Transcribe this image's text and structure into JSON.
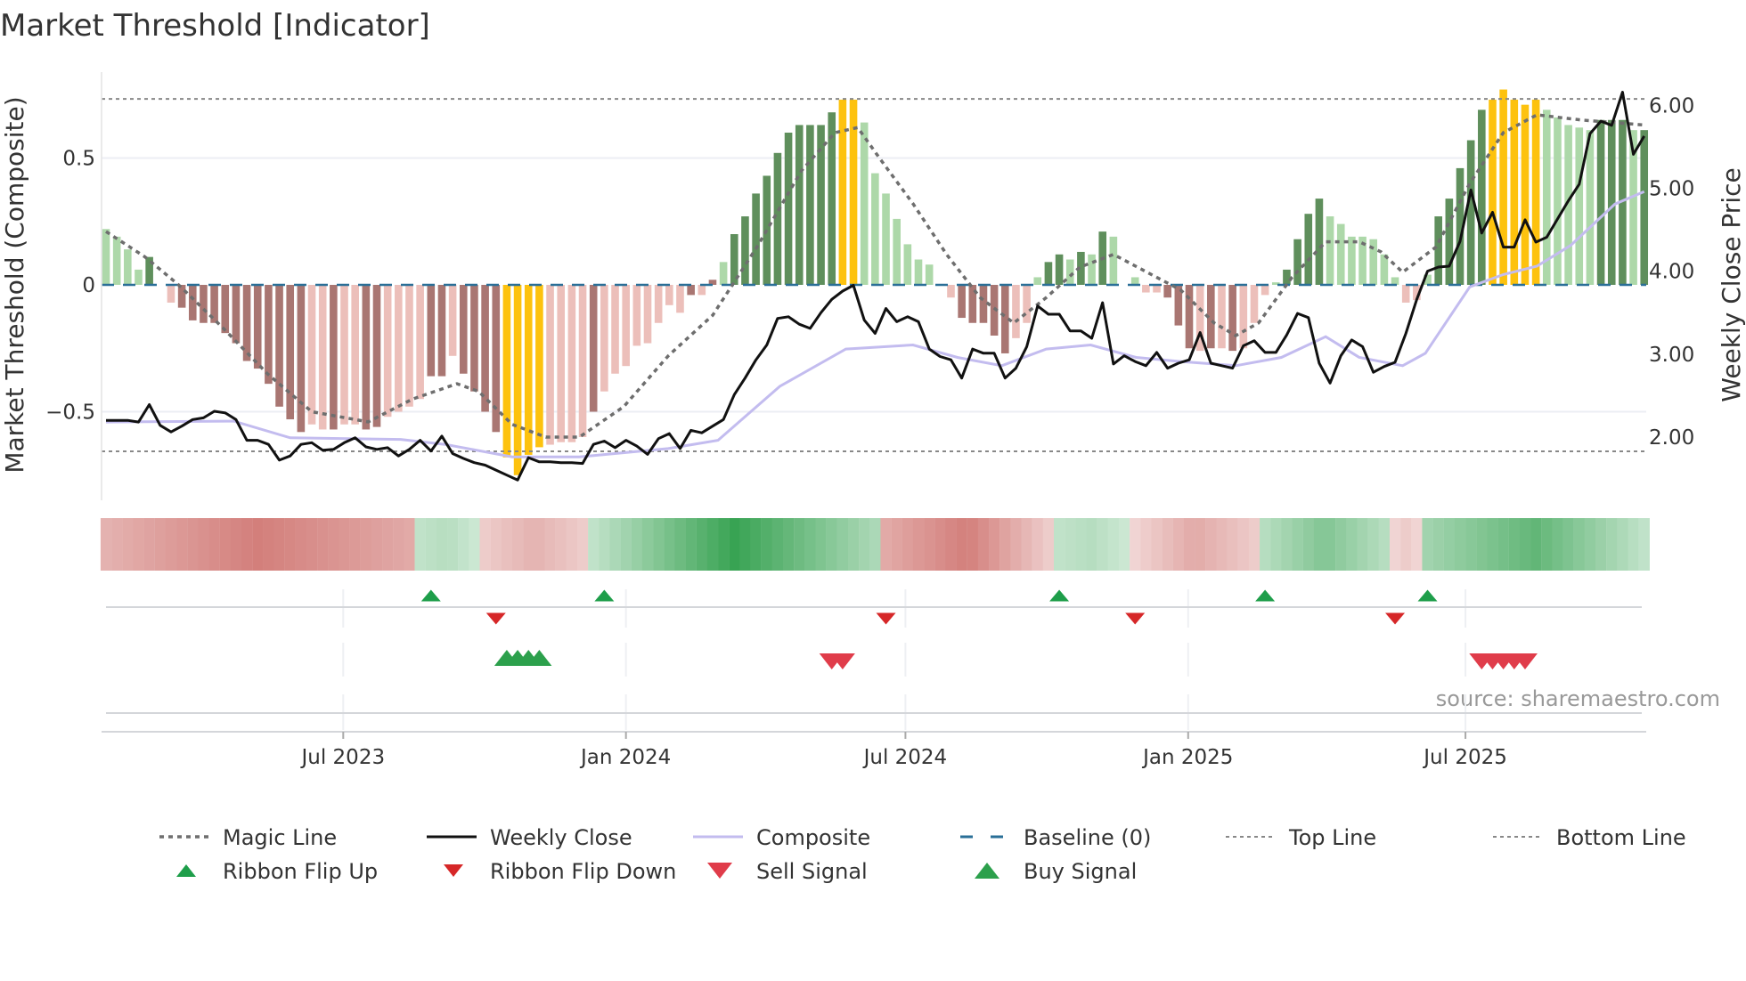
{
  "chart_data": {
    "type": "bar",
    "title": "Market Threshold [Indicator]",
    "ylabel": "Market Threshold (Composite)",
    "ylabel_right": "Weekly Close Price",
    "ylim": [
      -0.85,
      0.84
    ],
    "ylim_right": [
      1.23,
      6.39
    ],
    "yticks": [
      {
        "v": 0.5,
        "label": "0.5"
      },
      {
        "v": 0,
        "label": "0"
      },
      {
        "v": -0.5,
        "label": "−0.5"
      }
    ],
    "yticks_right": [
      {
        "v": 6,
        "label": "6.00"
      },
      {
        "v": 5,
        "label": "5.00"
      },
      {
        "v": 4,
        "label": "4.00"
      },
      {
        "v": 3,
        "label": "3.00"
      },
      {
        "v": 2,
        "label": "2.00"
      }
    ],
    "xticks": [
      {
        "week": 21.9,
        "label": "Jul 2023"
      },
      {
        "week": 48.0,
        "label": "Jan 2024"
      },
      {
        "week": 73.8,
        "label": "Jul 2024"
      },
      {
        "week": 99.9,
        "label": "Jan 2025"
      },
      {
        "week": 125.5,
        "label": "Jul 2025"
      }
    ],
    "top_line": 0.733,
    "bottom_line": -0.656,
    "bar_colors": {
      "g": "#5f8f5c",
      "l": "#add8a9",
      "r": "#a97672",
      "p": "#ecbfba",
      "y": "#fdc20e"
    },
    "composite_bars": {
      "values": [
        0.22,
        0.19,
        0.14,
        0.06,
        0.11,
        0,
        -0.07,
        -0.09,
        -0.14,
        -0.15,
        -0.15,
        -0.19,
        -0.23,
        -0.3,
        -0.33,
        -0.39,
        -0.48,
        -0.53,
        -0.58,
        -0.55,
        -0.57,
        -0.57,
        -0.55,
        -0.55,
        -0.57,
        -0.56,
        -0.52,
        -0.5,
        -0.48,
        -0.45,
        -0.36,
        -0.36,
        -0.28,
        -0.35,
        -0.42,
        -0.5,
        -0.58,
        -0.68,
        -0.75,
        -0.67,
        -0.64,
        -0.63,
        -0.62,
        -0.62,
        -0.6,
        -0.5,
        -0.42,
        -0.35,
        -0.32,
        -0.24,
        -0.23,
        -0.15,
        -0.08,
        -0.11,
        -0.04,
        -0.04,
        0.02,
        0.09,
        0.2,
        0.27,
        0.36,
        0.43,
        0.52,
        0.6,
        0.63,
        0.63,
        0.63,
        0.68,
        0.73,
        0.73,
        0.64,
        0.44,
        0.36,
        0.26,
        0.16,
        0.1,
        0.08,
        0,
        -0.05,
        -0.13,
        -0.15,
        -0.15,
        -0.2,
        -0.27,
        -0.21,
        -0.15,
        0.03,
        0.09,
        0.12,
        0.1,
        0.13,
        0.12,
        0.21,
        0.19,
        0,
        0.03,
        -0.03,
        -0.03,
        -0.05,
        -0.16,
        -0.25,
        -0.26,
        -0.25,
        -0.25,
        -0.26,
        -0.25,
        -0.15,
        -0.04,
        0.01,
        0.06,
        0.18,
        0.28,
        0.34,
        0.27,
        0.24,
        0.19,
        0.19,
        0.18,
        0.12,
        0.03,
        -0.07,
        -0.06,
        0.04,
        0.27,
        0.34,
        0.46,
        0.57,
        0.69,
        0.73,
        0.77,
        0.73,
        0.71,
        0.73,
        0.69,
        0.66,
        0.63,
        0.62,
        0.61,
        0.65,
        0.65,
        0.65,
        0.61,
        0.61
      ],
      "colors": "llllglprrrrrrrrrrrrpprpprrpppprrprrrryyyypppprpppppppprprlggggggggggyylllllllpprrrrrpplgglglglllpprrrprprppplgggglllllllpplgggggyyyyylllllggglg"
    },
    "weekly_close": [
      2.19,
      2.19,
      2.19,
      2.17,
      2.38,
      2.13,
      2.05,
      2.12,
      2.2,
      2.22,
      2.3,
      2.28,
      2.2,
      1.95,
      1.95,
      1.9,
      1.71,
      1.76,
      1.9,
      1.92,
      1.83,
      1.84,
      1.92,
      1.98,
      1.87,
      1.84,
      1.86,
      1.76,
      1.84,
      1.95,
      1.82,
      2.0,
      1.79,
      1.73,
      1.68,
      1.65,
      1.59,
      1.53,
      1.47,
      1.74,
      1.69,
      1.69,
      1.68,
      1.68,
      1.67,
      1.9,
      1.94,
      1.86,
      1.95,
      1.88,
      1.78,
      1.97,
      2.03,
      1.85,
      2.07,
      2.04,
      2.12,
      2.2,
      2.5,
      2.7,
      2.92,
      3.1,
      3.42,
      3.44,
      3.35,
      3.3,
      3.49,
      3.65,
      3.75,
      3.82,
      3.4,
      3.24,
      3.54,
      3.38,
      3.44,
      3.38,
      3.05,
      2.96,
      2.92,
      2.7,
      3.05,
      3.0,
      3.0,
      2.7,
      2.82,
      3.08,
      3.57,
      3.47,
      3.47,
      3.27,
      3.27,
      3.18,
      3.61,
      2.87,
      2.97,
      2.9,
      2.85,
      3.01,
      2.82,
      2.88,
      2.92,
      3.25,
      2.88,
      2.85,
      2.82,
      3.09,
      3.15,
      3.01,
      3.01,
      3.22,
      3.48,
      3.43,
      2.88,
      2.64,
      2.97,
      3.16,
      3.08,
      2.77,
      2.84,
      2.89,
      3.24,
      3.65,
      3.99,
      4.04,
      4.05,
      4.35,
      4.97,
      4.45,
      4.7,
      4.28,
      4.28,
      4.61,
      4.34,
      4.4,
      4.62,
      4.84,
      5.04,
      5.65,
      5.8,
      5.75,
      6.15,
      5.4,
      5.62
    ],
    "composite_line": [
      [
        0,
        2.17
      ],
      [
        11.8,
        2.18
      ],
      [
        17,
        1.98
      ],
      [
        27.2,
        1.96
      ],
      [
        31.3,
        1.9
      ],
      [
        37.5,
        1.75
      ],
      [
        43.7,
        1.75
      ],
      [
        51.9,
        1.85
      ],
      [
        56.5,
        1.95
      ],
      [
        62.2,
        2.6
      ],
      [
        68.3,
        3.05
      ],
      [
        74.5,
        3.1
      ],
      [
        78.6,
        2.95
      ],
      [
        82.7,
        2.85
      ],
      [
        86.8,
        3.05
      ],
      [
        90.9,
        3.1
      ],
      [
        95.1,
        2.95
      ],
      [
        99.2,
        2.9
      ],
      [
        104.3,
        2.85
      ],
      [
        108.5,
        2.95
      ],
      [
        112.6,
        3.2
      ],
      [
        115.7,
        2.95
      ],
      [
        119.7,
        2.85
      ],
      [
        121.8,
        3.0
      ],
      [
        125.9,
        3.8
      ],
      [
        129,
        3.95
      ],
      [
        132.1,
        4.05
      ],
      [
        135.2,
        4.3
      ],
      [
        139.3,
        4.8
      ],
      [
        142,
        4.95
      ]
    ],
    "magic_line": [
      [
        0,
        0.21
      ],
      [
        3.6,
        0.11
      ],
      [
        6.7,
        0
      ],
      [
        10.8,
        -0.17
      ],
      [
        14.9,
        -0.35
      ],
      [
        19,
        -0.5
      ],
      [
        24.2,
        -0.54
      ],
      [
        28.3,
        -0.45
      ],
      [
        32.4,
        -0.39
      ],
      [
        34.4,
        -0.42
      ],
      [
        37.5,
        -0.55
      ],
      [
        40.6,
        -0.6
      ],
      [
        43.7,
        -0.6
      ],
      [
        47.8,
        -0.48
      ],
      [
        51.9,
        -0.28
      ],
      [
        56,
        -0.12
      ],
      [
        60.1,
        0.15
      ],
      [
        64.2,
        0.45
      ],
      [
        67.3,
        0.6
      ],
      [
        69.4,
        0.62
      ],
      [
        71.4,
        0.5
      ],
      [
        74.5,
        0.32
      ],
      [
        77.6,
        0.12
      ],
      [
        80.7,
        -0.05
      ],
      [
        83.8,
        -0.15
      ],
      [
        86.8,
        -0.05
      ],
      [
        89.9,
        0.07
      ],
      [
        93,
        0.12
      ],
      [
        96.1,
        0.05
      ],
      [
        99.2,
        -0.02
      ],
      [
        102.3,
        -0.15
      ],
      [
        104.3,
        -0.2
      ],
      [
        106.4,
        -0.15
      ],
      [
        109.5,
        0.03
      ],
      [
        112.6,
        0.17
      ],
      [
        115.7,
        0.17
      ],
      [
        117.7,
        0.13
      ],
      [
        119.7,
        0.05
      ],
      [
        122.8,
        0.15
      ],
      [
        125.9,
        0.4
      ],
      [
        129,
        0.6
      ],
      [
        132.1,
        0.67
      ],
      [
        136.2,
        0.65
      ],
      [
        142,
        0.63
      ]
    ],
    "ribbon": [
      {
        "state": "bear",
        "from": 0,
        "to": 29,
        "strength": [
          0.45,
          0.75,
          0.5
        ]
      },
      {
        "state": "bull",
        "from": 29,
        "to": 35,
        "strength": [
          0.3,
          0.35,
          0.25
        ]
      },
      {
        "state": "bear",
        "from": 35,
        "to": 45,
        "strength": [
          0.3,
          0.45,
          0.3
        ]
      },
      {
        "state": "bull",
        "from": 45,
        "to": 72,
        "strength": [
          0.3,
          0.95,
          0.4
        ]
      },
      {
        "state": "bear",
        "from": 72,
        "to": 88,
        "strength": [
          0.5,
          0.75,
          0.3
        ]
      },
      {
        "state": "bull",
        "from": 88,
        "to": 95,
        "strength": [
          0.3,
          0.35,
          0.25
        ]
      },
      {
        "state": "bear",
        "from": 95,
        "to": 107,
        "strength": [
          0.25,
          0.5,
          0.3
        ]
      },
      {
        "state": "bull",
        "from": 107,
        "to": 119,
        "strength": [
          0.35,
          0.6,
          0.35
        ]
      },
      {
        "state": "bear",
        "from": 119,
        "to": 122,
        "strength": [
          0.25,
          0.3,
          0.25
        ]
      },
      {
        "state": "bull",
        "from": 122,
        "to": 143,
        "strength": [
          0.45,
          0.75,
          0.3
        ]
      }
    ],
    "ribbon_flip_up": [
      30,
      46,
      88,
      107,
      122
    ],
    "ribbon_flip_down": [
      36,
      72,
      95,
      119
    ],
    "buy_signals": [
      37,
      38,
      39,
      40
    ],
    "sell_signals": [
      67,
      68,
      127,
      128,
      129,
      130,
      131
    ],
    "colors": {
      "magic": "#6e6e6e",
      "close": "#111111",
      "composite": "#c3bcef",
      "baseline": "#2a6f97",
      "ref": "#888888",
      "flip_up": "#1e9e4a",
      "flip_down": "#d62728",
      "buy": "#2ca04c",
      "sell": "#e03c4a"
    },
    "legend": {
      "row1": [
        {
          "label": "Magic Line",
          "style": "magic"
        },
        {
          "label": "Weekly Close",
          "style": "close"
        },
        {
          "label": "Composite",
          "style": "composite"
        },
        {
          "label": "Baseline (0)",
          "style": "baseline"
        },
        {
          "label": "Top Line",
          "style": "ref"
        },
        {
          "label": "Bottom Line",
          "style": "ref"
        }
      ],
      "row2": [
        {
          "label": "Ribbon Flip Up",
          "style": "flip_up"
        },
        {
          "label": "Ribbon Flip Down",
          "style": "flip_down"
        },
        {
          "label": "Sell Signal",
          "style": "sell"
        },
        {
          "label": "Buy Signal",
          "style": "buy"
        }
      ],
      "placement": "bottom"
    },
    "source": "source: sharemaestro.com"
  }
}
